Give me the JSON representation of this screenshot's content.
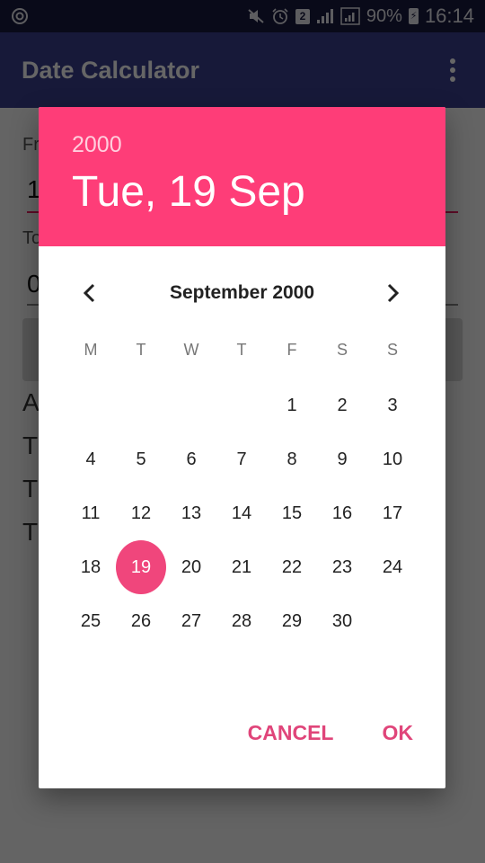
{
  "status_bar": {
    "left_icon": "sync-circle-icon",
    "icons": [
      "mute-icon",
      "alarm-icon",
      "sim2-icon",
      "signal-icon",
      "signal-boxed-icon"
    ],
    "sim_label": "2",
    "battery": "90%",
    "time": "16:14"
  },
  "app_bar": {
    "title": "Date Calculator",
    "menu_icon": "more-vertical-icon"
  },
  "background_form": {
    "from_label": "Fr",
    "from_value": "1",
    "to_label": "To",
    "to_value": "0",
    "result_lines": [
      "A",
      "T",
      "T",
      "T"
    ]
  },
  "dialog": {
    "year": "2000",
    "selected_date": "Tue, 19 Sep",
    "month_label": "September 2000",
    "prev_icon": "chevron-left-icon",
    "next_icon": "chevron-right-icon",
    "weekdays": [
      "M",
      "T",
      "W",
      "T",
      "F",
      "S",
      "S"
    ],
    "leading_blanks": 4,
    "days_in_month": 30,
    "selected_day": 19,
    "cancel_label": "CANCEL",
    "ok_label": "OK",
    "accent_color": "#fe3d78"
  }
}
